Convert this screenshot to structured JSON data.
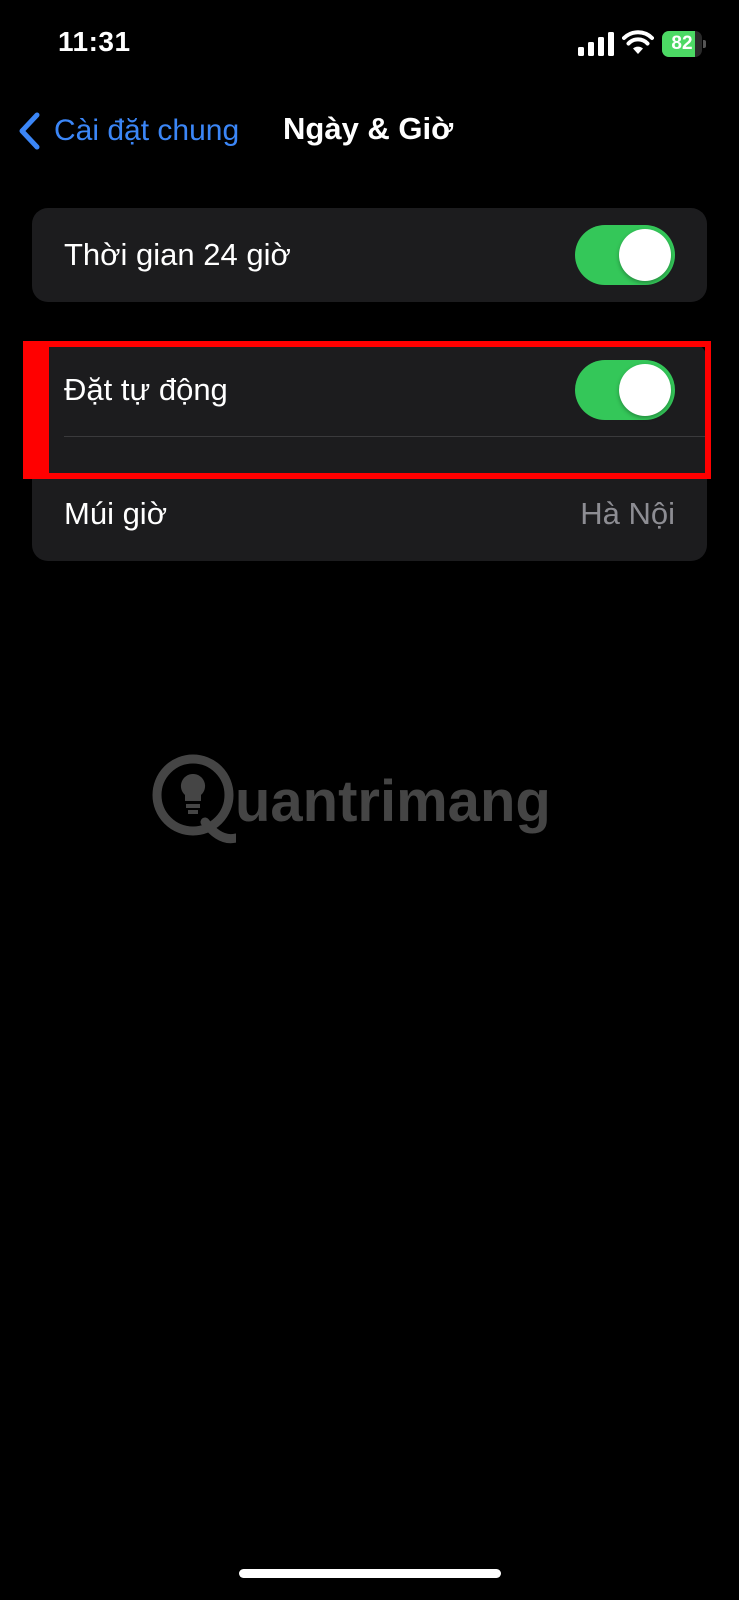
{
  "status_bar": {
    "time": "11:31",
    "battery_percent": "82",
    "battery_level": 0.82,
    "signal_icon": "cellular-signal-icon",
    "wifi_icon": "wifi-icon",
    "battery_color": "#4cd964"
  },
  "nav": {
    "back_icon": "chevron-left-icon",
    "back_label": "Cài đặt chung",
    "title": "Ngày & Giờ",
    "accent_color": "#3b86f7"
  },
  "groups": [
    {
      "rows": [
        {
          "label": "Thời gian 24 giờ",
          "type": "toggle",
          "on": true
        }
      ]
    },
    {
      "rows": [
        {
          "label": "Đặt tự động",
          "type": "toggle",
          "on": true
        },
        {
          "label": "Múi giờ",
          "type": "value",
          "value": "Hà Nội"
        }
      ]
    }
  ],
  "watermark": {
    "text": "uantrimang",
    "icon": "lightbulb-logo-icon"
  },
  "colors": {
    "toggle_on": "#34c759",
    "highlight": "#ff0000",
    "cell_background": "#1c1c1e"
  }
}
